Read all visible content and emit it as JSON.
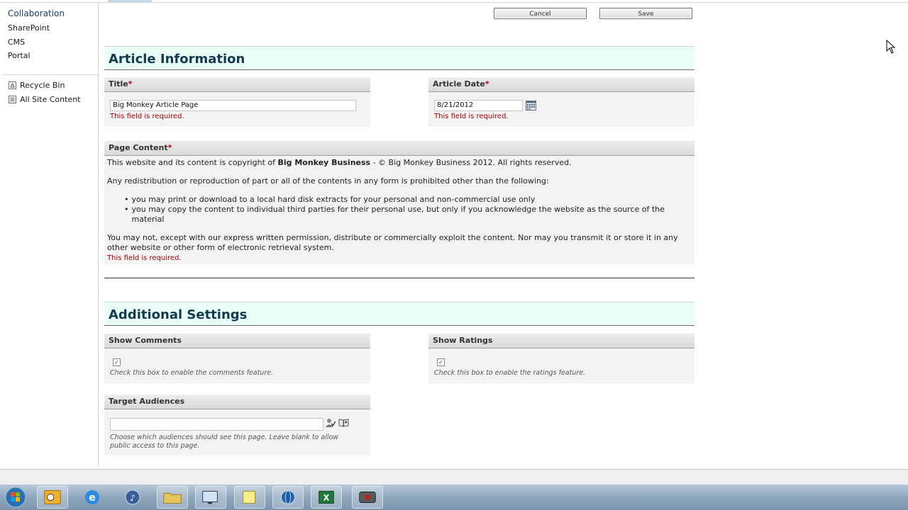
{
  "leftnav": {
    "heading": "Collaboration",
    "items": [
      "SharePoint",
      "CMS",
      "Portal"
    ],
    "tools": [
      {
        "label": "Recycle Bin",
        "icon": "recycle-bin-icon"
      },
      {
        "label": "All Site Content",
        "icon": "site-content-icon"
      }
    ]
  },
  "toolbar": {
    "cancel_label": "Cancel",
    "save_label": "Save"
  },
  "article_info": {
    "heading": "Article Information",
    "title_field": {
      "label": "Title",
      "required": "*",
      "value": "Big Monkey Article Page",
      "error": "This field is required."
    },
    "date_field": {
      "label": "Article Date",
      "required": "*",
      "value": "8/21/2012",
      "error": "This field is required."
    },
    "page_content": {
      "label": "Page Content",
      "required": "*",
      "para1_start": "This website and its content is copyright of ",
      "para1_bold": "Big Monkey Business",
      "para1_end": " - © Big Monkey Business 2012. All rights reserved.",
      "para2": "Any redistribution or reproduction of part or all of the contents in any form is prohibited other than the following:",
      "bullets": [
        "you may print or download to a local hard disk extracts for your personal and non-commercial use only",
        "you may copy the content to individual third parties for their personal use, but only if you acknowledge the website as the source of the material"
      ],
      "para3": "You may not, except with our express written permission, distribute or commercially exploit the content. Nor may you transmit it or store it in any other website or other form of electronic retrieval system.",
      "error": "This field is required."
    }
  },
  "additional": {
    "heading": "Additional Settings",
    "comments": {
      "label": "Show Comments",
      "hint": "Check this box to enable the comments feature."
    },
    "ratings": {
      "label": "Show Ratings",
      "hint": "Check this box to enable the ratings feature."
    },
    "audiences": {
      "label": "Target Audiences",
      "value": "",
      "hint": "Choose which audiences should see this page. Leave blank to allow public access to this page."
    }
  },
  "taskbar": {
    "items": [
      "start-orb-icon",
      "outlook-icon",
      "internet-explorer-icon",
      "itunes-icon",
      "file-explorer-icon",
      "remote-desktop-icon",
      "sticky-notes-icon",
      "browser-globe-icon",
      "excel-icon",
      "camtasia-icon"
    ]
  },
  "colors": {
    "section_bg": "#eafff5",
    "heading": "#123a52",
    "error": "#b00000",
    "link": "#1f3e6b"
  }
}
